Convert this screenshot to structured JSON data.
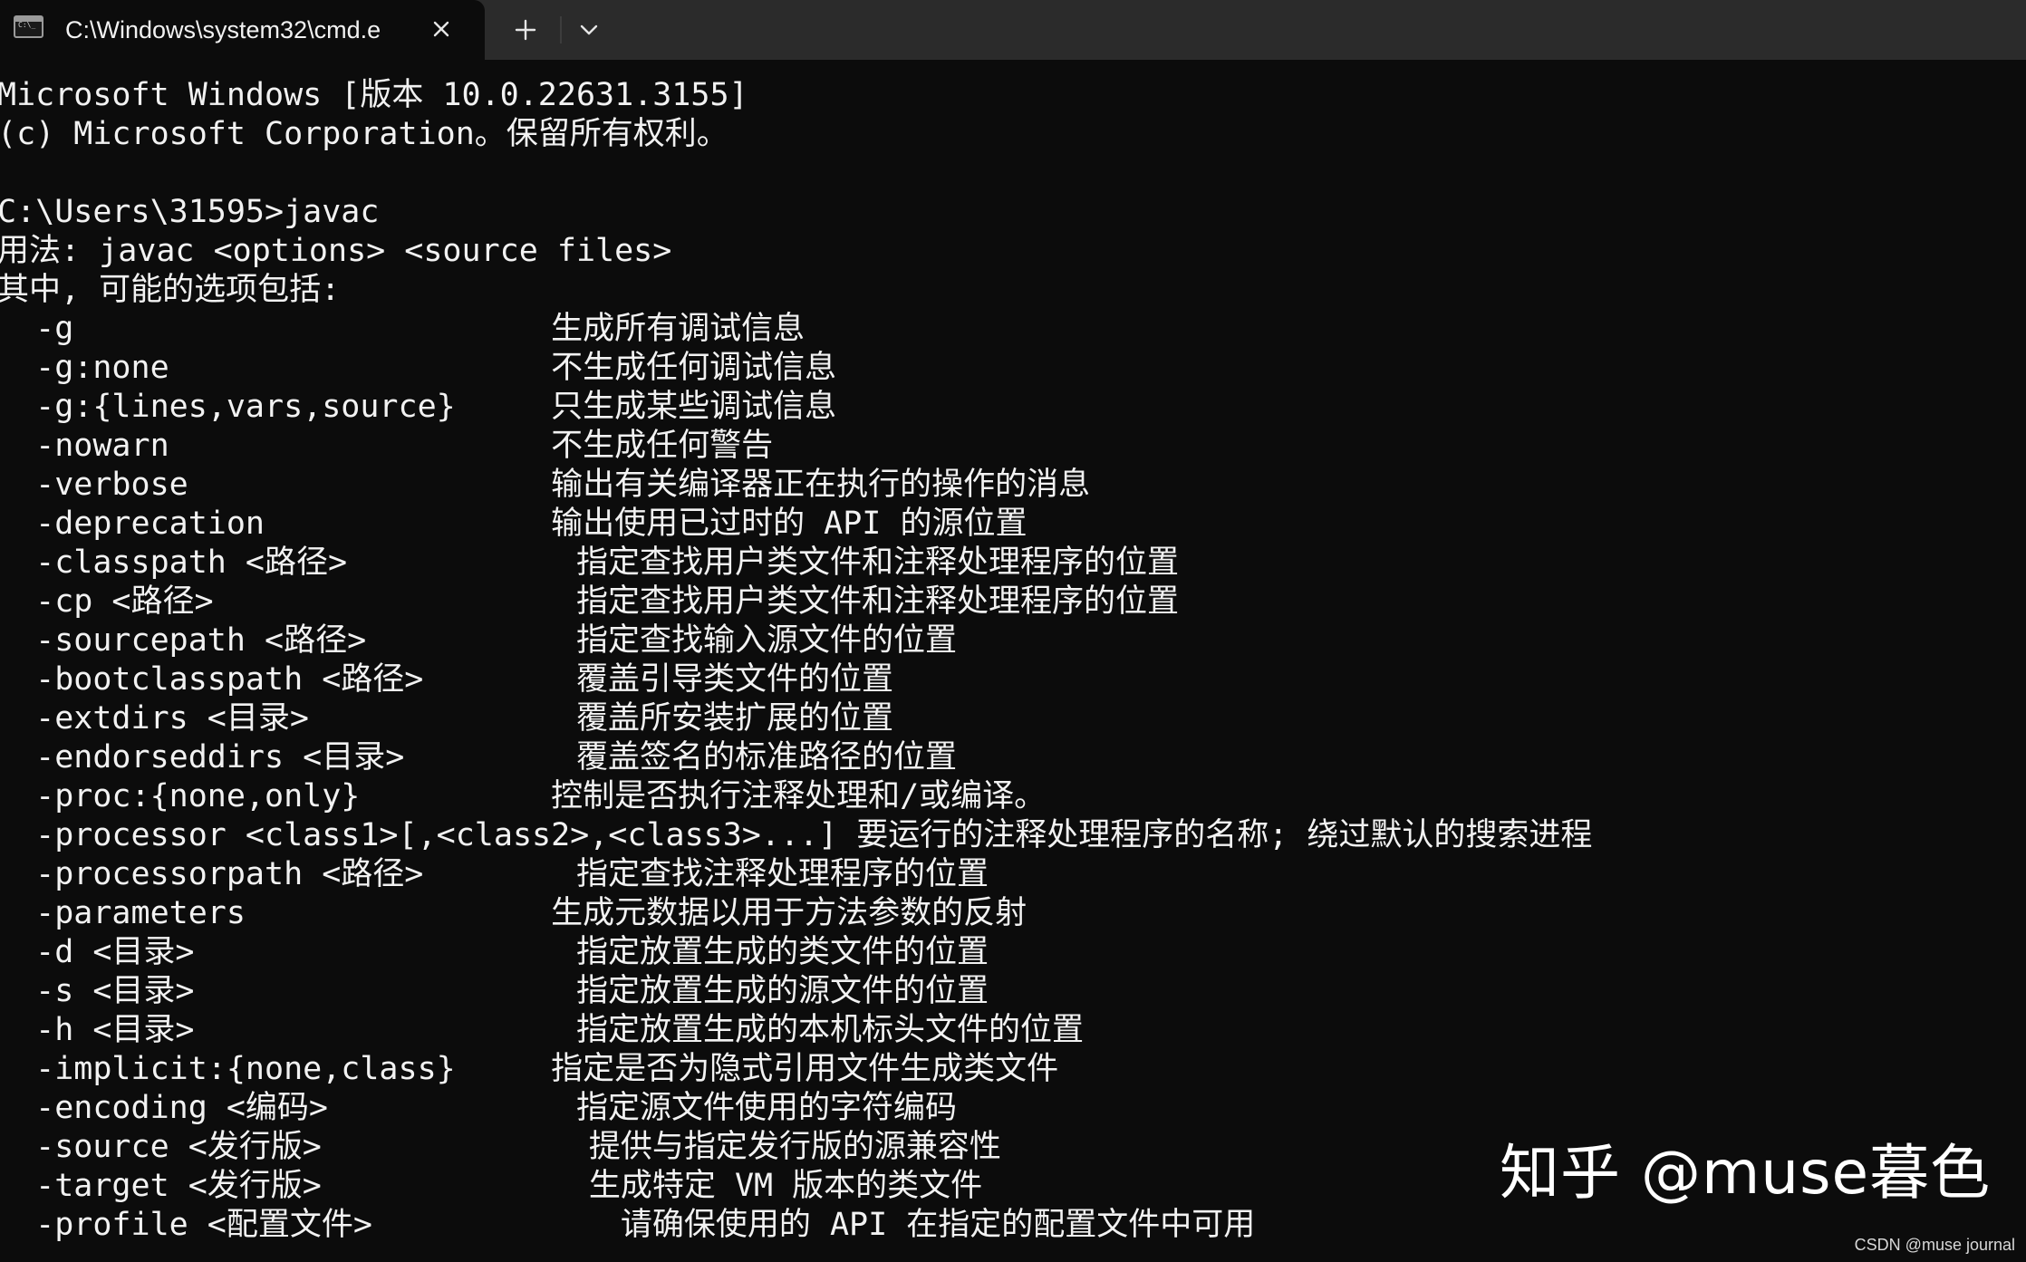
{
  "tab": {
    "title": "C:\\Windows\\system32\\cmd.e",
    "icon": "command-prompt-icon"
  },
  "tabbar": {
    "new_tab_icon": "plus-icon",
    "dropdown_icon": "chevron-down-icon",
    "close_icon": "close-icon"
  },
  "terminal": {
    "lines": [
      "Microsoft Windows [版本 10.0.22631.3155]",
      "(c) Microsoft Corporation。保留所有权利。",
      "",
      "C:\\Users\\31595>javac",
      "用法: javac <options> <source files>",
      "其中, 可能的选项包括:",
      "  -g                         生成所有调试信息",
      "  -g:none                    不生成任何调试信息",
      "  -g:{lines,vars,source}     只生成某些调试信息",
      "  -nowarn                    不生成任何警告",
      "  -verbose                   输出有关编译器正在执行的操作的消息",
      "  -deprecation               输出使用已过时的 API 的源位置",
      "  -classpath <路径>            指定查找用户类文件和注释处理程序的位置",
      "  -cp <路径>                   指定查找用户类文件和注释处理程序的位置",
      "  -sourcepath <路径>           指定查找输入源文件的位置",
      "  -bootclasspath <路径>        覆盖引导类文件的位置",
      "  -extdirs <目录>              覆盖所安装扩展的位置",
      "  -endorseddirs <目录>         覆盖签名的标准路径的位置",
      "  -proc:{none,only}          控制是否执行注释处理和/或编译。",
      "  -processor <class1>[,<class2>,<class3>...] 要运行的注释处理程序的名称; 绕过默认的搜索进程",
      "  -processorpath <路径>        指定查找注释处理程序的位置",
      "  -parameters                生成元数据以用于方法参数的反射",
      "  -d <目录>                    指定放置生成的类文件的位置",
      "  -s <目录>                    指定放置生成的源文件的位置",
      "  -h <目录>                    指定放置生成的本机标头文件的位置",
      "  -implicit:{none,class}     指定是否为隐式引用文件生成类文件",
      "  -encoding <编码>             指定源文件使用的字符编码",
      "  -source <发行版>              提供与指定发行版的源兼容性",
      "  -target <发行版>              生成特定 VM 版本的类文件",
      "  -profile <配置文件>             请确保使用的 API 在指定的配置文件中可用"
    ]
  },
  "watermark": {
    "text": "知乎 @muse暮色"
  },
  "credit": {
    "text": "CSDN @muse journal"
  }
}
